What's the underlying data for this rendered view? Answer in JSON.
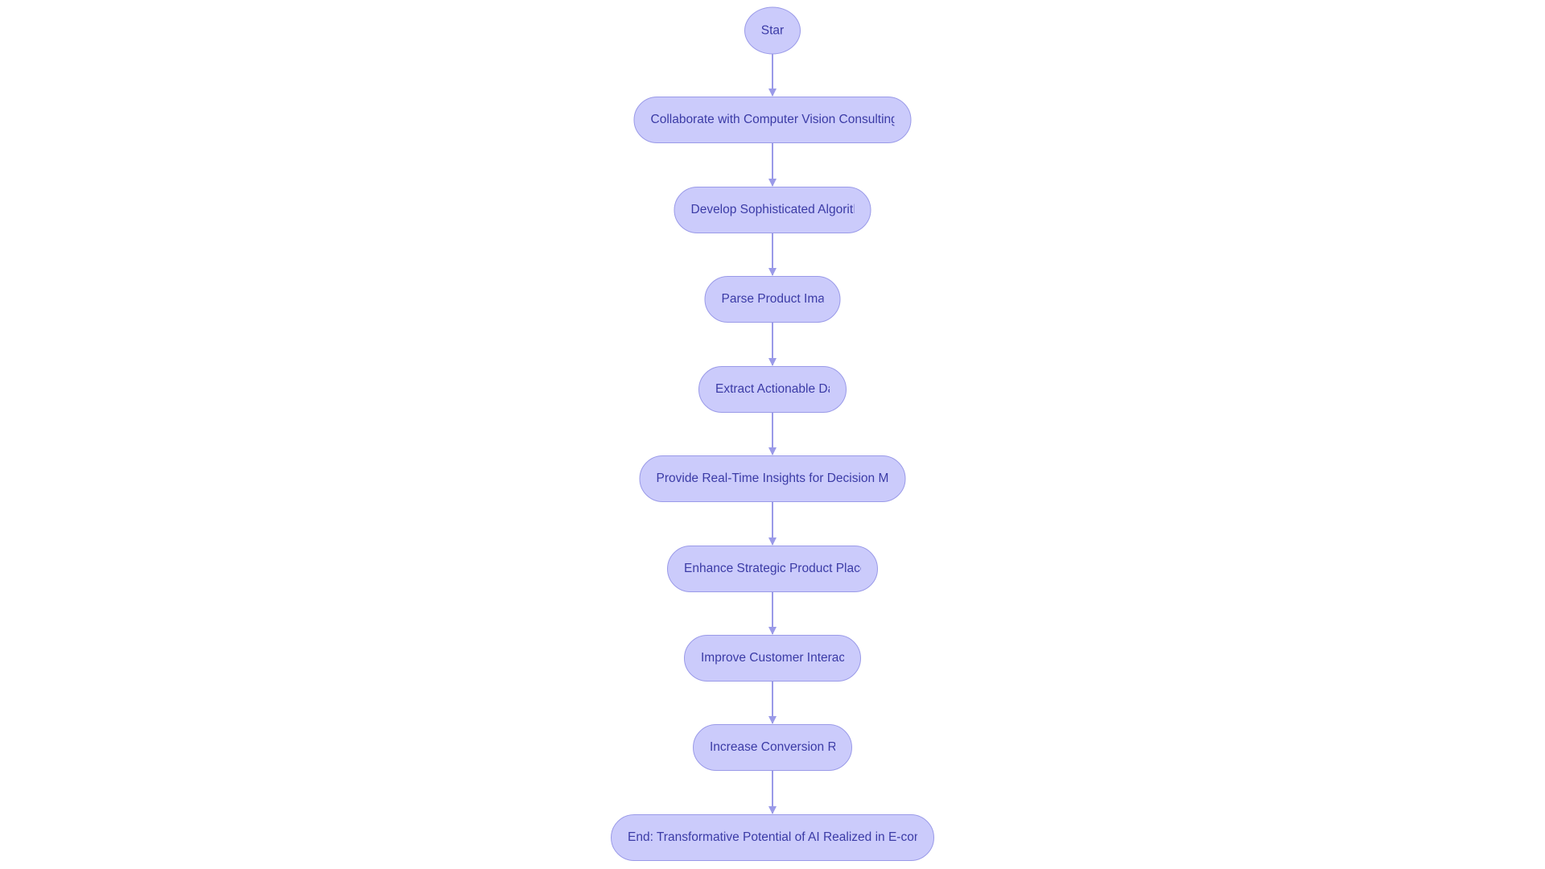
{
  "diagram": {
    "type": "flowchart",
    "direction": "top-down",
    "colors": {
      "node_fill": "#cbcbfb",
      "node_stroke": "#9a9ae8",
      "text": "#3b3ba6",
      "edge": "#9a9ae8"
    },
    "nodes": [
      {
        "label": "Star"
      },
      {
        "label": "Collaborate with Computer Vision Consulting"
      },
      {
        "label": "Develop Sophisticated Algorith"
      },
      {
        "label": "Parse Product Imag"
      },
      {
        "label": "Extract Actionable Da"
      },
      {
        "label": "Provide Real-Time Insights for Decision Mak"
      },
      {
        "label": "Enhance Strategic Product Place"
      },
      {
        "label": "Improve Customer Interact"
      },
      {
        "label": "Increase Conversion Ra"
      },
      {
        "label": "End: Transformative Potential of AI Realized in E-comm"
      }
    ]
  }
}
